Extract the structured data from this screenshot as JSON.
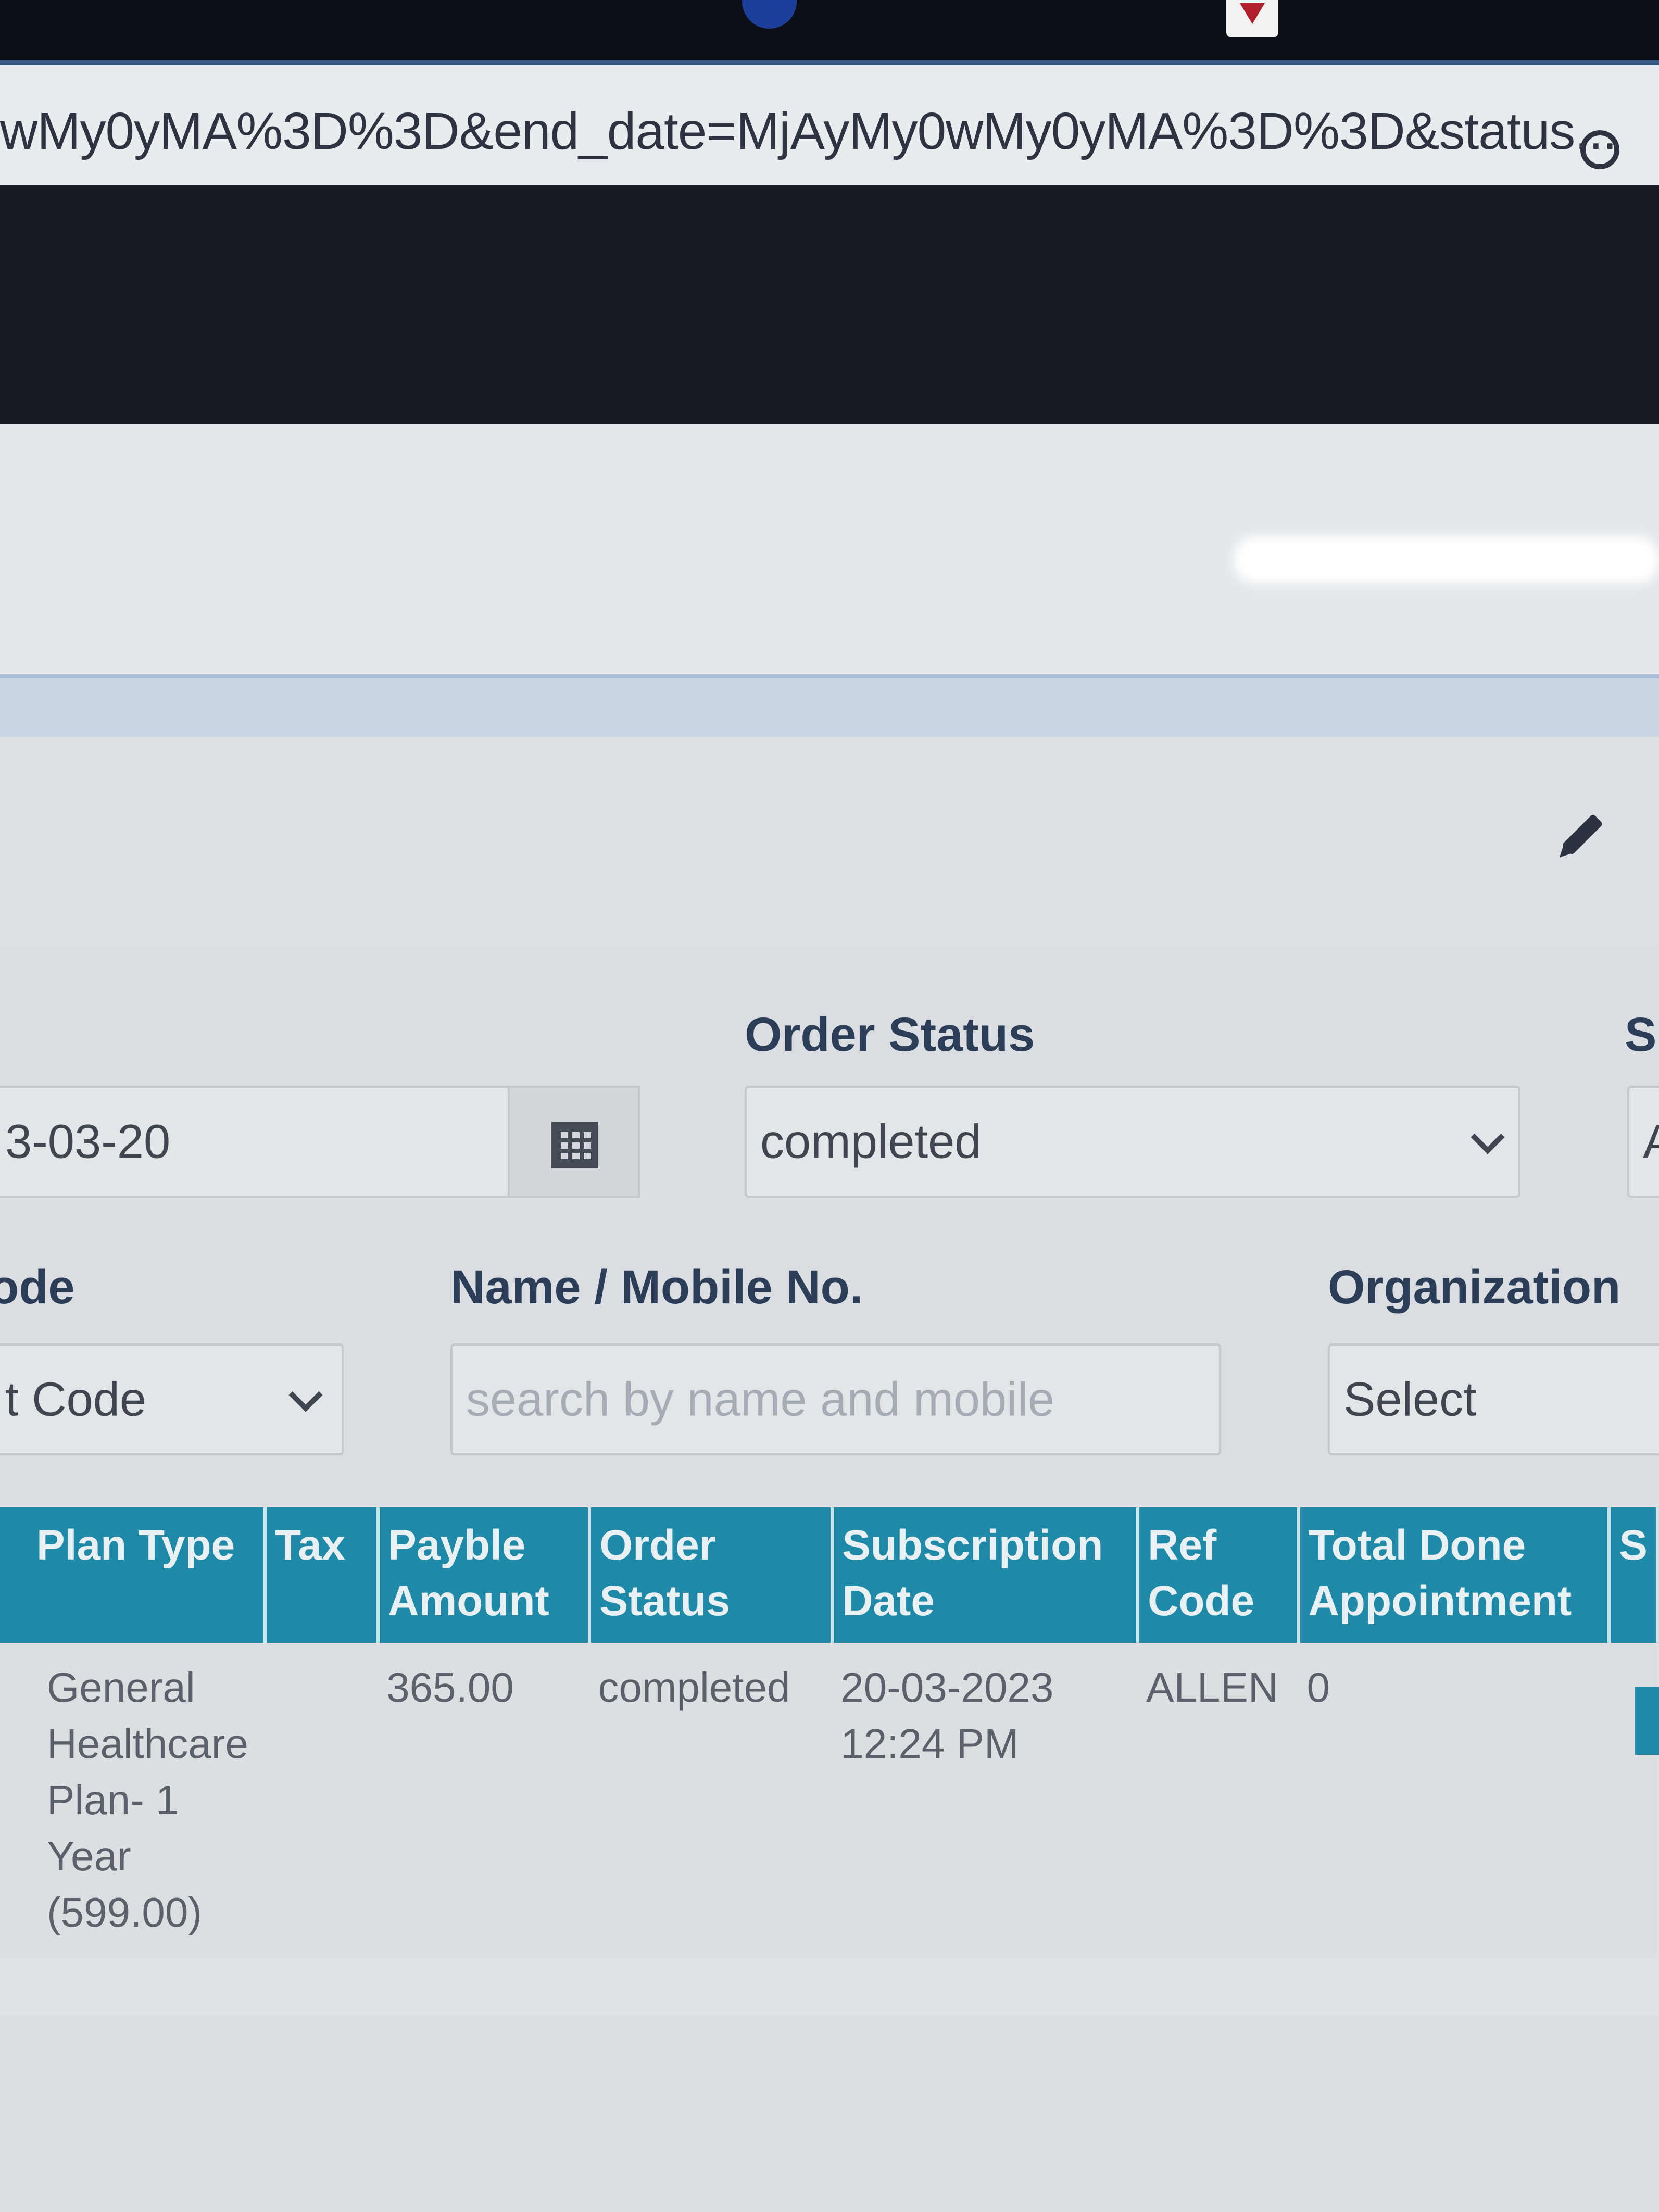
{
  "browser": {
    "url": "wMy0yMA%3D%3D&end_date=MjAyMy0wMy0yMA%3D%3D&status..."
  },
  "filters": {
    "order_status_label": "Order Status",
    "order_status_value": "completed",
    "date_value": "3-03-20",
    "s_label_partial": "S",
    "a_value_partial": "A",
    "code_label_partial": "ode",
    "code_select_value": "t Code",
    "name_label": "Name / Mobile No.",
    "name_placeholder": "search by name and mobile",
    "org_label": "Organization",
    "org_select_value": "Select"
  },
  "table": {
    "headers": [
      {
        "l1": "Plan Type",
        "l2": ""
      },
      {
        "l1": "Tax",
        "l2": ""
      },
      {
        "l1": "Payble",
        "l2": "Amount"
      },
      {
        "l1": "Order",
        "l2": "Status"
      },
      {
        "l1": "Subscription",
        "l2": "Date"
      },
      {
        "l1": "Ref",
        "l2": "Code"
      },
      {
        "l1": "Total Done",
        "l2": "Appointment"
      },
      {
        "l1": "S",
        "l2": ""
      }
    ],
    "rows": [
      {
        "plan_lines": [
          "General",
          "Healthcare",
          "Plan- 1",
          "Year",
          "(599.00)"
        ],
        "tax": "",
        "payable": "365.00",
        "status": "completed",
        "date": "20-03-2023",
        "time": "12:24 PM",
        "ref": "ALLEN",
        "total_done": "0"
      }
    ]
  },
  "colors": {
    "header_bg": "#1f8aa8",
    "page_bg": "#dadee2",
    "label_text": "#2c3e57"
  }
}
